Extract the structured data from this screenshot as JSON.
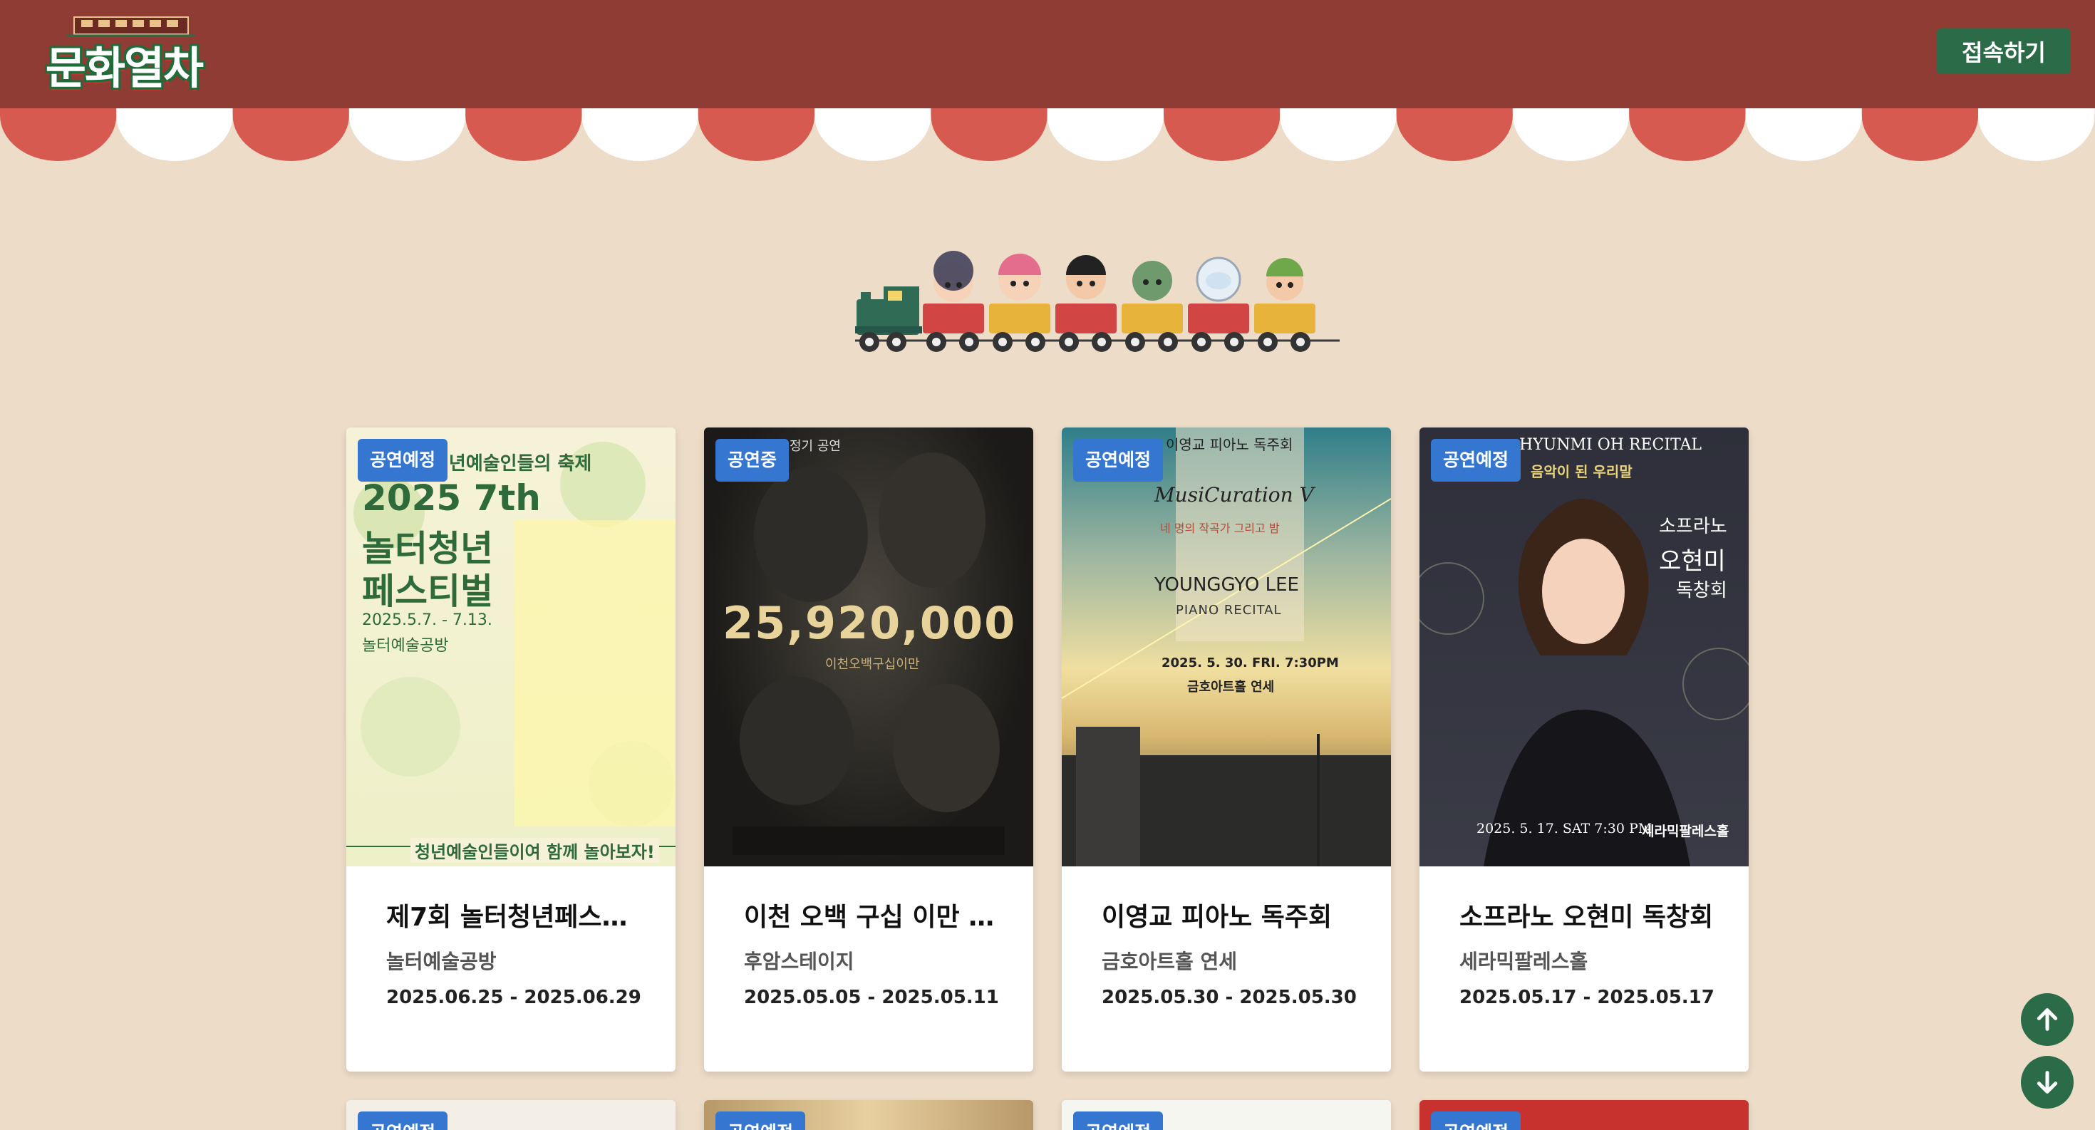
{
  "header": {
    "logo_text": "문화열차",
    "connect_label": "접속하기"
  },
  "cards": [
    {
      "status": "공연예정",
      "title": "제7회 놀터청년페스…",
      "venue": "놀터예술공방",
      "date": "2025.06.25 - 2025.06.29",
      "poster": {
        "top": "청년예술인들의 축제",
        "line1": "2025 7th",
        "line2": "놀터청년",
        "line3": "페스티벌",
        "dates": "2025.5.7. - 7.13.",
        "place": "놀터예술공방",
        "bottom": "청년예술인들이여 함께 놀아보자!"
      }
    },
    {
      "status": "공연중",
      "title": "이천 오백 구십 이만 [···",
      "venue": "후암스테이지",
      "date": "2025.05.05 - 2025.05.11",
      "poster": {
        "top": "정기 공연",
        "big": "25,920,000",
        "sub": "이천오백구십이만"
      }
    },
    {
      "status": "공연예정",
      "title": "이영교 피아노 독주회",
      "venue": "금호아트홀 연세",
      "date": "2025.05.30 - 2025.05.30",
      "poster": {
        "top": "이영교 피아노 독주회",
        "series": "MusiCuration V",
        "sub": "네 명의 작곡가 그리고 밤",
        "name": "YOUNGGYO LEE",
        "recital": "PIANO RECITAL",
        "when": "2025. 5. 30. FRI. 7:30PM",
        "hall": "금호아트홀 연세"
      }
    },
    {
      "status": "공연예정",
      "title": "소프라노 오현미 독창회",
      "venue": "세라믹팔레스홀",
      "date": "2025.05.17 - 2025.05.17",
      "poster": {
        "name_en": "HYUNMI OH RECITAL",
        "sub": "음악이 된 우리말",
        "role": "소프라노",
        "name": "오현미",
        "kind": "독창회",
        "when": "2025. 5. 17. SAT 7:30 PM",
        "hall": "세라믹팔레스홀"
      }
    }
  ],
  "row2_status": [
    "공연예정",
    "공연예정",
    "공연예정",
    "공연예정"
  ],
  "colors": {
    "header": "#8e3c34",
    "background": "#ecdcc8",
    "badge": "#3576d0",
    "button": "#2c6b48"
  },
  "icons": [
    "arrow-up-icon",
    "arrow-down-icon"
  ]
}
